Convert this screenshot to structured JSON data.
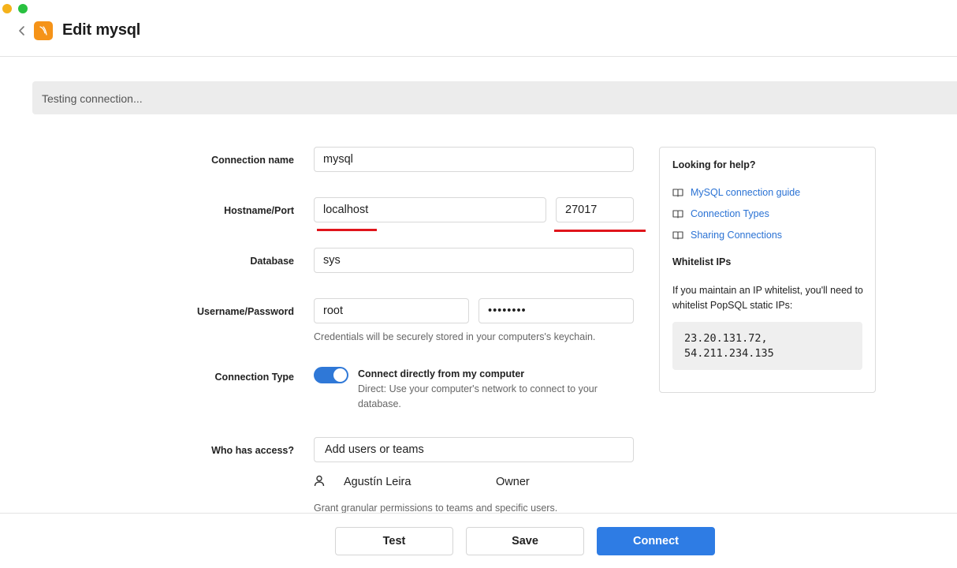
{
  "header": {
    "title": "Edit mysql"
  },
  "banner": {
    "text": "Testing connection..."
  },
  "form": {
    "connection_name": {
      "label": "Connection name",
      "value": "mysql"
    },
    "host_port": {
      "label": "Hostname/Port",
      "host": "localhost",
      "port": "27017"
    },
    "database": {
      "label": "Database",
      "value": "sys"
    },
    "credentials": {
      "label": "Username/Password",
      "username": "root",
      "password": "••••••••",
      "hint": "Credentials will be securely stored in your computers's keychain."
    },
    "connection_type": {
      "label": "Connection Type",
      "title": "Connect directly from my computer",
      "description": "Direct: Use your computer's network to connect to your database.",
      "enabled": true
    },
    "access": {
      "label": "Who has access?",
      "placeholder": "Add users or teams",
      "user": {
        "name": "Agustín Leira",
        "role": "Owner"
      },
      "hint": "Grant granular permissions to teams and specific users."
    }
  },
  "help": {
    "title": "Looking for help?",
    "links": [
      "MySQL connection guide",
      "Connection Types",
      "Sharing Connections"
    ],
    "whitelist_title": "Whitelist IPs",
    "whitelist_text": "If you maintain an IP whitelist, you'll need to whitelist PopSQL static IPs:",
    "ips": [
      "23.20.131.72,",
      "54.211.234.135"
    ]
  },
  "footer": {
    "test": "Test",
    "save": "Save",
    "connect": "Connect"
  },
  "colors": {
    "accent": "#2e7ce4",
    "brand": "#f59318",
    "error_underline": "#e0151b"
  }
}
